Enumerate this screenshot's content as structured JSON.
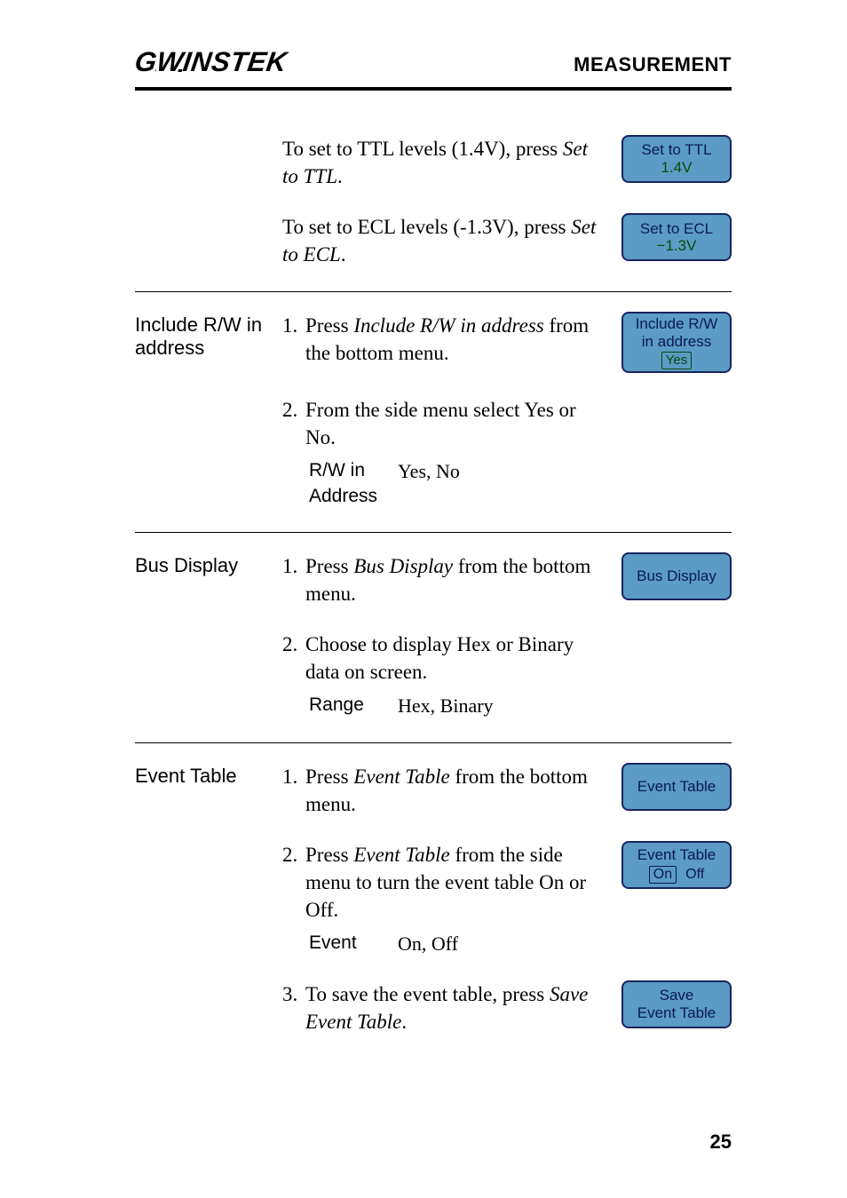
{
  "header": {
    "logo": "GWINSTEK",
    "section": "MEASUREMENT"
  },
  "page_number": "25",
  "blocks": {
    "ttl": {
      "text_pre": "To set to TTL levels (1.4V), press ",
      "text_em": "Set to TTL",
      "text_post": ".",
      "button_line1": "Set to TTL",
      "button_line2": "1.4V"
    },
    "ecl": {
      "text_pre": "To set to ECL levels (-1.3V), press ",
      "text_em": "Set to ECL",
      "text_post": ".",
      "button_line1": "Set to ECL",
      "button_line2": "−1.3V"
    },
    "include_rw": {
      "label": "Include R/W in address",
      "step1_num": "1.",
      "step1_pre": "Press ",
      "step1_em": "Include R/W in address",
      "step1_post": " from the bottom menu.",
      "step2_num": "2.",
      "step2_text": "From the side menu select Yes or No.",
      "opt_key": "R/W in Address",
      "opt_val": "Yes, No",
      "button_line1": "Include R/W",
      "button_line2": "in address",
      "button_pill": "Yes"
    },
    "bus_display": {
      "label": "Bus Display",
      "step1_num": "1.",
      "step1_pre": "Press ",
      "step1_em": "Bus Display",
      "step1_post": " from the bottom menu.",
      "step2_num": "2.",
      "step2_text": "Choose to display Hex or Binary data on screen.",
      "opt_key": "Range",
      "opt_val": "Hex, Binary",
      "button_line1": "Bus Display"
    },
    "event_table": {
      "label": "Event Table",
      "step1_num": "1.",
      "step1_pre": "Press ",
      "step1_em": "Event Table",
      "step1_post": " from the bottom menu.",
      "step2_num": "2.",
      "step2_pre": "Press ",
      "step2_em": "Event Table",
      "step2_post": " from the side menu to turn the event table On or Off.",
      "opt_key": "Event",
      "opt_val": "On, Off",
      "step3_num": "3.",
      "step3_pre": "To save the event table, press ",
      "step3_em": "Save Event Table",
      "step3_post": ".",
      "button1_line1": "Event Table",
      "button2_line1": "Event Table",
      "button2_on": "On",
      "button2_off": "Off",
      "button3_line1": "Save",
      "button3_line2": "Event Table"
    }
  }
}
